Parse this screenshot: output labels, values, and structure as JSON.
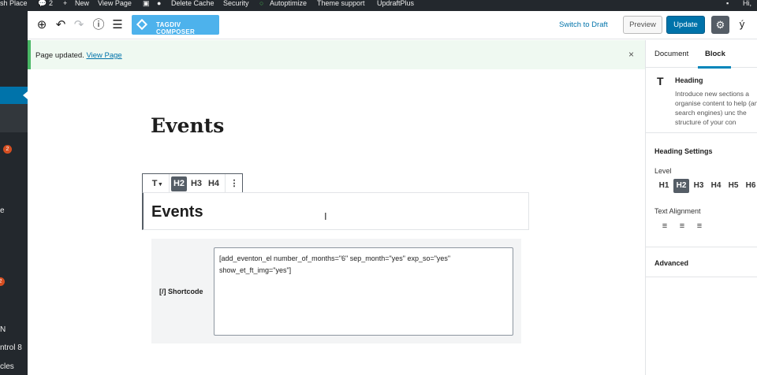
{
  "adminbar": {
    "site": "sh Place",
    "comments_count": "2",
    "new_label": "New",
    "view_page": "View Page",
    "delete_cache": "Delete Cache",
    "security": "Security",
    "autoptimize": "Autoptimize",
    "theme_support": "Theme support",
    "updraftplus": "UpdraftPlus",
    "greeting": "Hi, "
  },
  "sidebar": {
    "badge_1": "2",
    "badge_2": "2",
    "label_1": "e",
    "label_2": "N",
    "label_3": "ntrol 8",
    "label_4": "cles"
  },
  "toolbar": {
    "tagdiv_label": "TAGDIV COMPOSER",
    "switch_to_draft": "Switch to Draft",
    "preview": "Preview",
    "update": "Update"
  },
  "notice": {
    "message": "Page updated.",
    "link": "View Page",
    "close": "×"
  },
  "editor": {
    "title": "Events",
    "heading_text": "Events",
    "block_toolbar": {
      "transform": "T",
      "h2": "H2",
      "h3": "H3",
      "h4": "H4",
      "more": "⋮"
    },
    "shortcode": {
      "label": "Shortcode",
      "content": "[add_eventon_el number_of_months=\"6\" sep_month=\"yes\" exp_so=\"yes\" show_et_ft_img=\"yes\"]"
    }
  },
  "settings_panel": {
    "tabs": [
      "Document",
      "Block"
    ],
    "active_tab": "Block",
    "block_name": "Heading",
    "block_description": "Introduce new sections a organise content to help (and search engines) unc the structure of your con",
    "heading_settings": "Heading Settings",
    "level_label": "Level",
    "levels": [
      "H1",
      "H2",
      "H3",
      "H4",
      "H5",
      "H6"
    ],
    "active_level": "H2",
    "text_alignment_label": "Text Alignment",
    "advanced": "Advanced"
  },
  "colors": {
    "accent": "#0073aa",
    "admin_dark": "#23282d",
    "notice_green": "#4ab866",
    "tagdiv_blue": "#4db2ec"
  }
}
